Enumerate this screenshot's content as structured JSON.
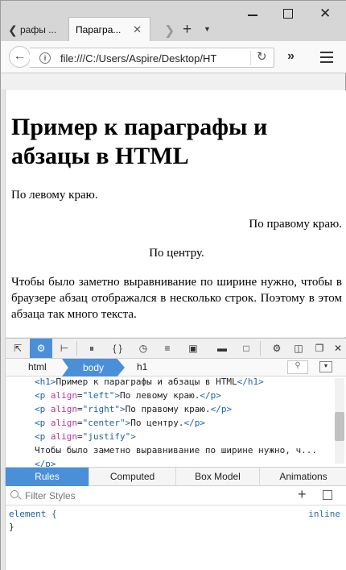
{
  "tabs": [
    {
      "label": "рафы ..."
    },
    {
      "label": "Парагра..."
    }
  ],
  "nav": {
    "url": "file:///C:/Users/Aspire/Desktop/HT"
  },
  "page": {
    "heading": "Пример к параграфы и абзацы в HTML",
    "p_left": "По левому краю.",
    "p_right": "По правому краю.",
    "p_center": "По центру.",
    "p_justify": "Чтобы было заметно выравнивание по ширине нужно, чтобы в браузере абзац отображался в несколько строк. Поэтому в этом абзаца так много текста."
  },
  "devtools": {
    "breadcrumbs": [
      "html",
      "body",
      "h1"
    ],
    "markup_lines": [
      {
        "tag_open": "<h1>",
        "text": "Пример к параграфы и абзацы в HTML",
        "tag_close": "</h1>"
      },
      {
        "tag_open": "<p ",
        "attr": "align",
        "val": "\"left\"",
        "text": "По левому краю.",
        "tag_close": "</p>"
      },
      {
        "tag_open": "<p ",
        "attr": "align",
        "val": "\"right\"",
        "text": "По правому краю.",
        "tag_close": "</p>"
      },
      {
        "tag_open": "<p ",
        "attr": "align",
        "val": "\"center\"",
        "text": "По центру.",
        "tag_close": "</p>"
      },
      {
        "tag_open": "<p ",
        "attr": "align",
        "val": "\"justify\"",
        "text": "",
        "tag_close": ""
      },
      {
        "text": "Чтобы было заметно выравнивание по ширине нужно, ч..."
      },
      {
        "tag_close": "</p>"
      }
    ],
    "side_tabs": [
      "Rules",
      "Computed",
      "Box Model",
      "Animations"
    ],
    "filter_placeholder": "Filter Styles",
    "rule_selector": "element {",
    "rule_source": "inline",
    "rule_end": "}"
  },
  "colors": {
    "accent": "#4a90d9",
    "tag": "#1f61a8",
    "attr": "#b3368f"
  }
}
